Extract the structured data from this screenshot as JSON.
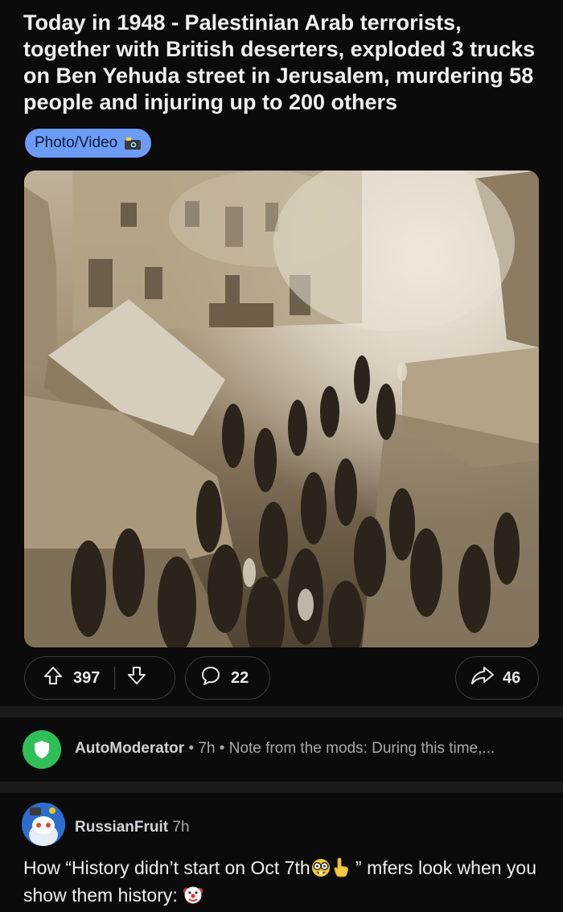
{
  "post": {
    "title": "Today in 1948 - Palestinian Arab terrorists, together with British deserters, exploded 3 trucks on Ben Yehuda street in Jerusalem, murdering 58 people and injuring up to 200 others",
    "flair": "Photo/Video",
    "flair_color": "#6d9cf7",
    "flair_icon": "camera-flash-icon"
  },
  "actions": {
    "upvotes": "397",
    "comments": "22",
    "shares": "46",
    "icons": [
      "upvote-arrow-icon",
      "downvote-arrow-icon",
      "comment-bubble-icon",
      "share-arrow-icon"
    ]
  },
  "automod": {
    "username": "AutoModerator",
    "time": "7h",
    "separator": "•",
    "snippet": "Note from the mods: During this time,...",
    "avatar_color": "#2fbf58"
  },
  "comment": {
    "username": "RussianFruit",
    "time": "7h",
    "text_part1": "How “History didn’t start on Oct 7th",
    "text_part2": " ” mfers look when you show them history: ",
    "emojis": [
      "nerd-face-emoji",
      "pointing-finger-emoji",
      "clown-face-emoji"
    ]
  }
}
